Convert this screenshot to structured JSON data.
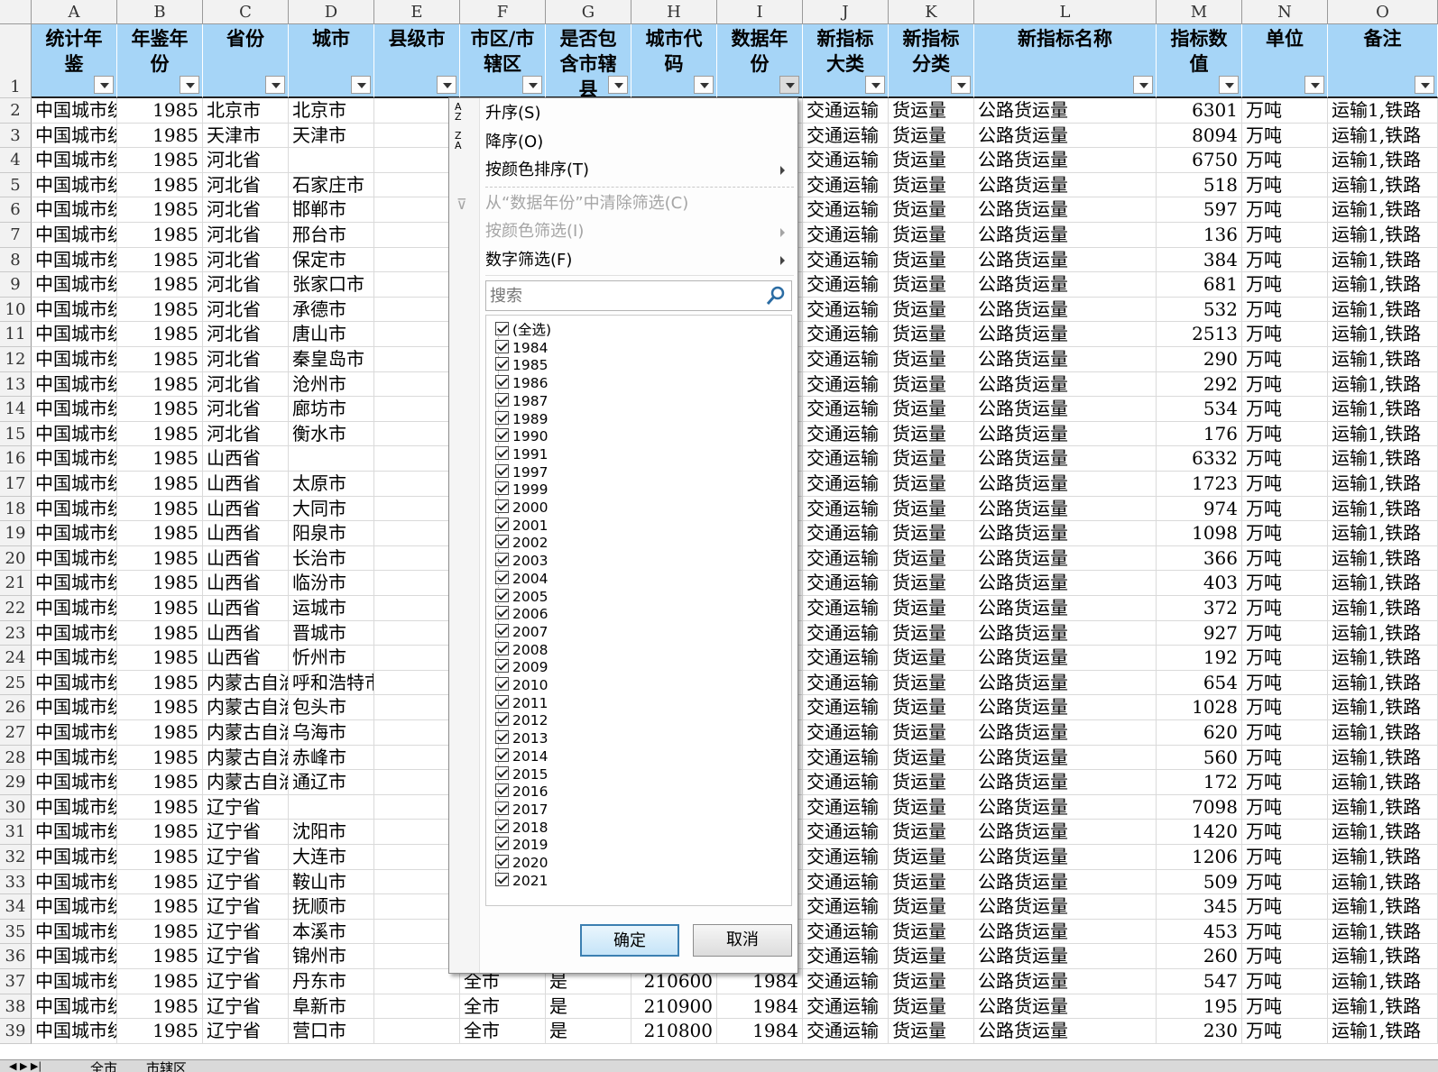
{
  "columns": [
    "A",
    "B",
    "C",
    "D",
    "E",
    "F",
    "G",
    "H",
    "I",
    "J",
    "K",
    "L",
    "M",
    "N",
    "O"
  ],
  "headers": [
    "统计年鉴",
    "年鉴年份",
    "省份",
    "城市",
    "县级市",
    "市区/市辖区",
    "是否包含市辖县",
    "城市代码",
    "数据年份",
    "新指标大类",
    "新指标分类",
    "新指标名称",
    "指标数值",
    "单位",
    "备注"
  ],
  "header_lines": [
    [
      "统计年",
      "鉴"
    ],
    [
      "年鉴年",
      "份"
    ],
    [
      "省份"
    ],
    [
      "城市"
    ],
    [
      "县级市"
    ],
    [
      "市区/市",
      "辖区"
    ],
    [
      "是否包",
      "含市辖",
      "县"
    ],
    [
      "城市代",
      "码"
    ],
    [
      "数据年",
      "份"
    ],
    [
      "新指标",
      "大类"
    ],
    [
      "新指标",
      "分类"
    ],
    [
      "新指标名称"
    ],
    [
      "指标数",
      "值"
    ],
    [
      "单位"
    ],
    [
      "备注"
    ]
  ],
  "header_row_num": "1",
  "rows": [
    {
      "n": "2",
      "a": "中国城市统",
      "b": "1985",
      "c": "北京市",
      "d": "北京市",
      "f": "",
      "g": "",
      "h": "",
      "i": "",
      "j": "交通运输",
      "k": "货运量",
      "l": "公路货运量",
      "m": "6301",
      "u": "万吨",
      "o": "运输1,铁路"
    },
    {
      "n": "3",
      "a": "中国城市统",
      "b": "1985",
      "c": "天津市",
      "d": "天津市",
      "f": "",
      "g": "",
      "h": "",
      "i": "",
      "j": "交通运输",
      "k": "货运量",
      "l": "公路货运量",
      "m": "8094",
      "u": "万吨",
      "o": "运输1,铁路"
    },
    {
      "n": "4",
      "a": "中国城市统",
      "b": "1985",
      "c": "河北省",
      "d": "",
      "f": "",
      "g": "",
      "h": "",
      "i": "",
      "j": "交通运输",
      "k": "货运量",
      "l": "公路货运量",
      "m": "6750",
      "u": "万吨",
      "o": "运输1,铁路"
    },
    {
      "n": "5",
      "a": "中国城市统",
      "b": "1985",
      "c": "河北省",
      "d": "石家庄市",
      "f": "",
      "g": "",
      "h": "",
      "i": "",
      "j": "交通运输",
      "k": "货运量",
      "l": "公路货运量",
      "m": "518",
      "u": "万吨",
      "o": "运输1,铁路"
    },
    {
      "n": "6",
      "a": "中国城市统",
      "b": "1985",
      "c": "河北省",
      "d": "邯郸市",
      "f": "",
      "g": "",
      "h": "",
      "i": "",
      "j": "交通运输",
      "k": "货运量",
      "l": "公路货运量",
      "m": "597",
      "u": "万吨",
      "o": "运输1,铁路"
    },
    {
      "n": "7",
      "a": "中国城市统",
      "b": "1985",
      "c": "河北省",
      "d": "邢台市",
      "f": "",
      "g": "",
      "h": "",
      "i": "",
      "j": "交通运输",
      "k": "货运量",
      "l": "公路货运量",
      "m": "136",
      "u": "万吨",
      "o": "运输1,铁路"
    },
    {
      "n": "8",
      "a": "中国城市统",
      "b": "1985",
      "c": "河北省",
      "d": "保定市",
      "f": "",
      "g": "",
      "h": "",
      "i": "",
      "j": "交通运输",
      "k": "货运量",
      "l": "公路货运量",
      "m": "384",
      "u": "万吨",
      "o": "运输1,铁路"
    },
    {
      "n": "9",
      "a": "中国城市统",
      "b": "1985",
      "c": "河北省",
      "d": "张家口市",
      "f": "",
      "g": "",
      "h": "",
      "i": "",
      "j": "交通运输",
      "k": "货运量",
      "l": "公路货运量",
      "m": "681",
      "u": "万吨",
      "o": "运输1,铁路"
    },
    {
      "n": "10",
      "a": "中国城市统",
      "b": "1985",
      "c": "河北省",
      "d": "承德市",
      "f": "",
      "g": "",
      "h": "",
      "i": "",
      "j": "交通运输",
      "k": "货运量",
      "l": "公路货运量",
      "m": "532",
      "u": "万吨",
      "o": "运输1,铁路"
    },
    {
      "n": "11",
      "a": "中国城市统",
      "b": "1985",
      "c": "河北省",
      "d": "唐山市",
      "f": "",
      "g": "",
      "h": "",
      "i": "",
      "j": "交通运输",
      "k": "货运量",
      "l": "公路货运量",
      "m": "2513",
      "u": "万吨",
      "o": "运输1,铁路"
    },
    {
      "n": "12",
      "a": "中国城市统",
      "b": "1985",
      "c": "河北省",
      "d": "秦皇岛市",
      "f": "",
      "g": "",
      "h": "",
      "i": "",
      "j": "交通运输",
      "k": "货运量",
      "l": "公路货运量",
      "m": "290",
      "u": "万吨",
      "o": "运输1,铁路"
    },
    {
      "n": "13",
      "a": "中国城市统",
      "b": "1985",
      "c": "河北省",
      "d": "沧州市",
      "f": "",
      "g": "",
      "h": "",
      "i": "",
      "j": "交通运输",
      "k": "货运量",
      "l": "公路货运量",
      "m": "292",
      "u": "万吨",
      "o": "运输1,铁路"
    },
    {
      "n": "14",
      "a": "中国城市统",
      "b": "1985",
      "c": "河北省",
      "d": "廊坊市",
      "f": "",
      "g": "",
      "h": "",
      "i": "",
      "j": "交通运输",
      "k": "货运量",
      "l": "公路货运量",
      "m": "534",
      "u": "万吨",
      "o": "运输1,铁路"
    },
    {
      "n": "15",
      "a": "中国城市统",
      "b": "1985",
      "c": "河北省",
      "d": "衡水市",
      "f": "",
      "g": "",
      "h": "",
      "i": "",
      "j": "交通运输",
      "k": "货运量",
      "l": "公路货运量",
      "m": "176",
      "u": "万吨",
      "o": "运输1,铁路"
    },
    {
      "n": "16",
      "a": "中国城市统",
      "b": "1985",
      "c": "山西省",
      "d": "",
      "f": "",
      "g": "",
      "h": "",
      "i": "",
      "j": "交通运输",
      "k": "货运量",
      "l": "公路货运量",
      "m": "6332",
      "u": "万吨",
      "o": "运输1,铁路"
    },
    {
      "n": "17",
      "a": "中国城市统",
      "b": "1985",
      "c": "山西省",
      "d": "太原市",
      "f": "",
      "g": "",
      "h": "",
      "i": "",
      "j": "交通运输",
      "k": "货运量",
      "l": "公路货运量",
      "m": "1723",
      "u": "万吨",
      "o": "运输1,铁路"
    },
    {
      "n": "18",
      "a": "中国城市统",
      "b": "1985",
      "c": "山西省",
      "d": "大同市",
      "f": "",
      "g": "",
      "h": "",
      "i": "",
      "j": "交通运输",
      "k": "货运量",
      "l": "公路货运量",
      "m": "974",
      "u": "万吨",
      "o": "运输1,铁路"
    },
    {
      "n": "19",
      "a": "中国城市统",
      "b": "1985",
      "c": "山西省",
      "d": "阳泉市",
      "f": "",
      "g": "",
      "h": "",
      "i": "",
      "j": "交通运输",
      "k": "货运量",
      "l": "公路货运量",
      "m": "1098",
      "u": "万吨",
      "o": "运输1,铁路"
    },
    {
      "n": "20",
      "a": "中国城市统",
      "b": "1985",
      "c": "山西省",
      "d": "长治市",
      "f": "",
      "g": "",
      "h": "",
      "i": "",
      "j": "交通运输",
      "k": "货运量",
      "l": "公路货运量",
      "m": "366",
      "u": "万吨",
      "o": "运输1,铁路"
    },
    {
      "n": "21",
      "a": "中国城市统",
      "b": "1985",
      "c": "山西省",
      "d": "临汾市",
      "f": "",
      "g": "",
      "h": "",
      "i": "",
      "j": "交通运输",
      "k": "货运量",
      "l": "公路货运量",
      "m": "403",
      "u": "万吨",
      "o": "运输1,铁路"
    },
    {
      "n": "22",
      "a": "中国城市统",
      "b": "1985",
      "c": "山西省",
      "d": "运城市",
      "f": "",
      "g": "",
      "h": "",
      "i": "",
      "j": "交通运输",
      "k": "货运量",
      "l": "公路货运量",
      "m": "372",
      "u": "万吨",
      "o": "运输1,铁路"
    },
    {
      "n": "23",
      "a": "中国城市统",
      "b": "1985",
      "c": "山西省",
      "d": "晋城市",
      "f": "",
      "g": "",
      "h": "",
      "i": "",
      "j": "交通运输",
      "k": "货运量",
      "l": "公路货运量",
      "m": "927",
      "u": "万吨",
      "o": "运输1,铁路"
    },
    {
      "n": "24",
      "a": "中国城市统",
      "b": "1985",
      "c": "山西省",
      "d": "忻州市",
      "f": "",
      "g": "",
      "h": "",
      "i": "",
      "j": "交通运输",
      "k": "货运量",
      "l": "公路货运量",
      "m": "192",
      "u": "万吨",
      "o": "运输1,铁路"
    },
    {
      "n": "25",
      "a": "中国城市统",
      "b": "1985",
      "c": "内蒙古自治",
      "d": "呼和浩特市",
      "f": "",
      "g": "",
      "h": "",
      "i": "",
      "j": "交通运输",
      "k": "货运量",
      "l": "公路货运量",
      "m": "654",
      "u": "万吨",
      "o": "运输1,铁路"
    },
    {
      "n": "26",
      "a": "中国城市统",
      "b": "1985",
      "c": "内蒙古自治",
      "d": "包头市",
      "f": "",
      "g": "",
      "h": "",
      "i": "",
      "j": "交通运输",
      "k": "货运量",
      "l": "公路货运量",
      "m": "1028",
      "u": "万吨",
      "o": "运输1,铁路"
    },
    {
      "n": "27",
      "a": "中国城市统",
      "b": "1985",
      "c": "内蒙古自治",
      "d": "乌海市",
      "f": "",
      "g": "",
      "h": "",
      "i": "",
      "j": "交通运输",
      "k": "货运量",
      "l": "公路货运量",
      "m": "620",
      "u": "万吨",
      "o": "运输1,铁路"
    },
    {
      "n": "28",
      "a": "中国城市统",
      "b": "1985",
      "c": "内蒙古自治",
      "d": "赤峰市",
      "f": "",
      "g": "",
      "h": "",
      "i": "",
      "j": "交通运输",
      "k": "货运量",
      "l": "公路货运量",
      "m": "560",
      "u": "万吨",
      "o": "运输1,铁路"
    },
    {
      "n": "29",
      "a": "中国城市统",
      "b": "1985",
      "c": "内蒙古自治",
      "d": "通辽市",
      "f": "",
      "g": "",
      "h": "",
      "i": "",
      "j": "交通运输",
      "k": "货运量",
      "l": "公路货运量",
      "m": "172",
      "u": "万吨",
      "o": "运输1,铁路"
    },
    {
      "n": "30",
      "a": "中国城市统",
      "b": "1985",
      "c": "辽宁省",
      "d": "",
      "f": "",
      "g": "",
      "h": "",
      "i": "",
      "j": "交通运输",
      "k": "货运量",
      "l": "公路货运量",
      "m": "7098",
      "u": "万吨",
      "o": "运输1,铁路"
    },
    {
      "n": "31",
      "a": "中国城市统",
      "b": "1985",
      "c": "辽宁省",
      "d": "沈阳市",
      "f": "",
      "g": "",
      "h": "",
      "i": "",
      "j": "交通运输",
      "k": "货运量",
      "l": "公路货运量",
      "m": "1420",
      "u": "万吨",
      "o": "运输1,铁路"
    },
    {
      "n": "32",
      "a": "中国城市统",
      "b": "1985",
      "c": "辽宁省",
      "d": "大连市",
      "f": "",
      "g": "",
      "h": "",
      "i": "",
      "j": "交通运输",
      "k": "货运量",
      "l": "公路货运量",
      "m": "1206",
      "u": "万吨",
      "o": "运输1,铁路"
    },
    {
      "n": "33",
      "a": "中国城市统",
      "b": "1985",
      "c": "辽宁省",
      "d": "鞍山市",
      "f": "",
      "g": "",
      "h": "",
      "i": "",
      "j": "交通运输",
      "k": "货运量",
      "l": "公路货运量",
      "m": "509",
      "u": "万吨",
      "o": "运输1,铁路"
    },
    {
      "n": "34",
      "a": "中国城市统",
      "b": "1985",
      "c": "辽宁省",
      "d": "抚顺市",
      "f": "",
      "g": "",
      "h": "",
      "i": "",
      "j": "交通运输",
      "k": "货运量",
      "l": "公路货运量",
      "m": "345",
      "u": "万吨",
      "o": "运输1,铁路"
    },
    {
      "n": "35",
      "a": "中国城市统",
      "b": "1985",
      "c": "辽宁省",
      "d": "本溪市",
      "f": "",
      "g": "",
      "h": "",
      "i": "",
      "j": "交通运输",
      "k": "货运量",
      "l": "公路货运量",
      "m": "453",
      "u": "万吨",
      "o": "运输1,铁路"
    },
    {
      "n": "36",
      "a": "中国城市统",
      "b": "1985",
      "c": "辽宁省",
      "d": "锦州市",
      "f": "",
      "g": "",
      "h": "",
      "i": "",
      "j": "交通运输",
      "k": "货运量",
      "l": "公路货运量",
      "m": "260",
      "u": "万吨",
      "o": "运输1,铁路"
    },
    {
      "n": "37",
      "a": "中国城市统",
      "b": "1985",
      "c": "辽宁省",
      "d": "丹东市",
      "f": "全市",
      "g": "是",
      "h": "210600",
      "i": "1984",
      "j": "交通运输",
      "k": "货运量",
      "l": "公路货运量",
      "m": "547",
      "u": "万吨",
      "o": "运输1,铁路"
    },
    {
      "n": "38",
      "a": "中国城市统",
      "b": "1985",
      "c": "辽宁省",
      "d": "阜新市",
      "f": "全市",
      "g": "是",
      "h": "210900",
      "i": "1984",
      "j": "交通运输",
      "k": "货运量",
      "l": "公路货运量",
      "m": "195",
      "u": "万吨",
      "o": "运输1,铁路"
    },
    {
      "n": "39",
      "a": "中国城市统",
      "b": "1985",
      "c": "辽宁省",
      "d": "营口市",
      "f": "全市",
      "g": "是",
      "h": "210800",
      "i": "1984",
      "j": "交通运输",
      "k": "货运量",
      "l": "公路货运量",
      "m": "230",
      "u": "万吨",
      "o": "运输1,铁路"
    }
  ],
  "filter_menu": {
    "sort_asc": "升序(S)",
    "sort_desc": "降序(O)",
    "sort_by_color": "按颜色排序(T)",
    "clear_filter": "从“数据年份”中清除筛选(C)",
    "filter_by_color": "按颜色筛选(I)",
    "number_filter": "数字筛选(F)",
    "search_placeholder": "搜索",
    "items": [
      "(全选)",
      "1984",
      "1985",
      "1986",
      "1987",
      "1989",
      "1990",
      "1991",
      "1997",
      "1999",
      "2000",
      "2001",
      "2002",
      "2003",
      "2004",
      "2005",
      "2006",
      "2007",
      "2008",
      "2009",
      "2010",
      "2011",
      "2012",
      "2013",
      "2014",
      "2015",
      "2016",
      "2017",
      "2018",
      "2019",
      "2020",
      "2021"
    ],
    "ok": "确定",
    "cancel": "取消"
  },
  "sheet_tabs": [
    "全市",
    "市辖区"
  ]
}
